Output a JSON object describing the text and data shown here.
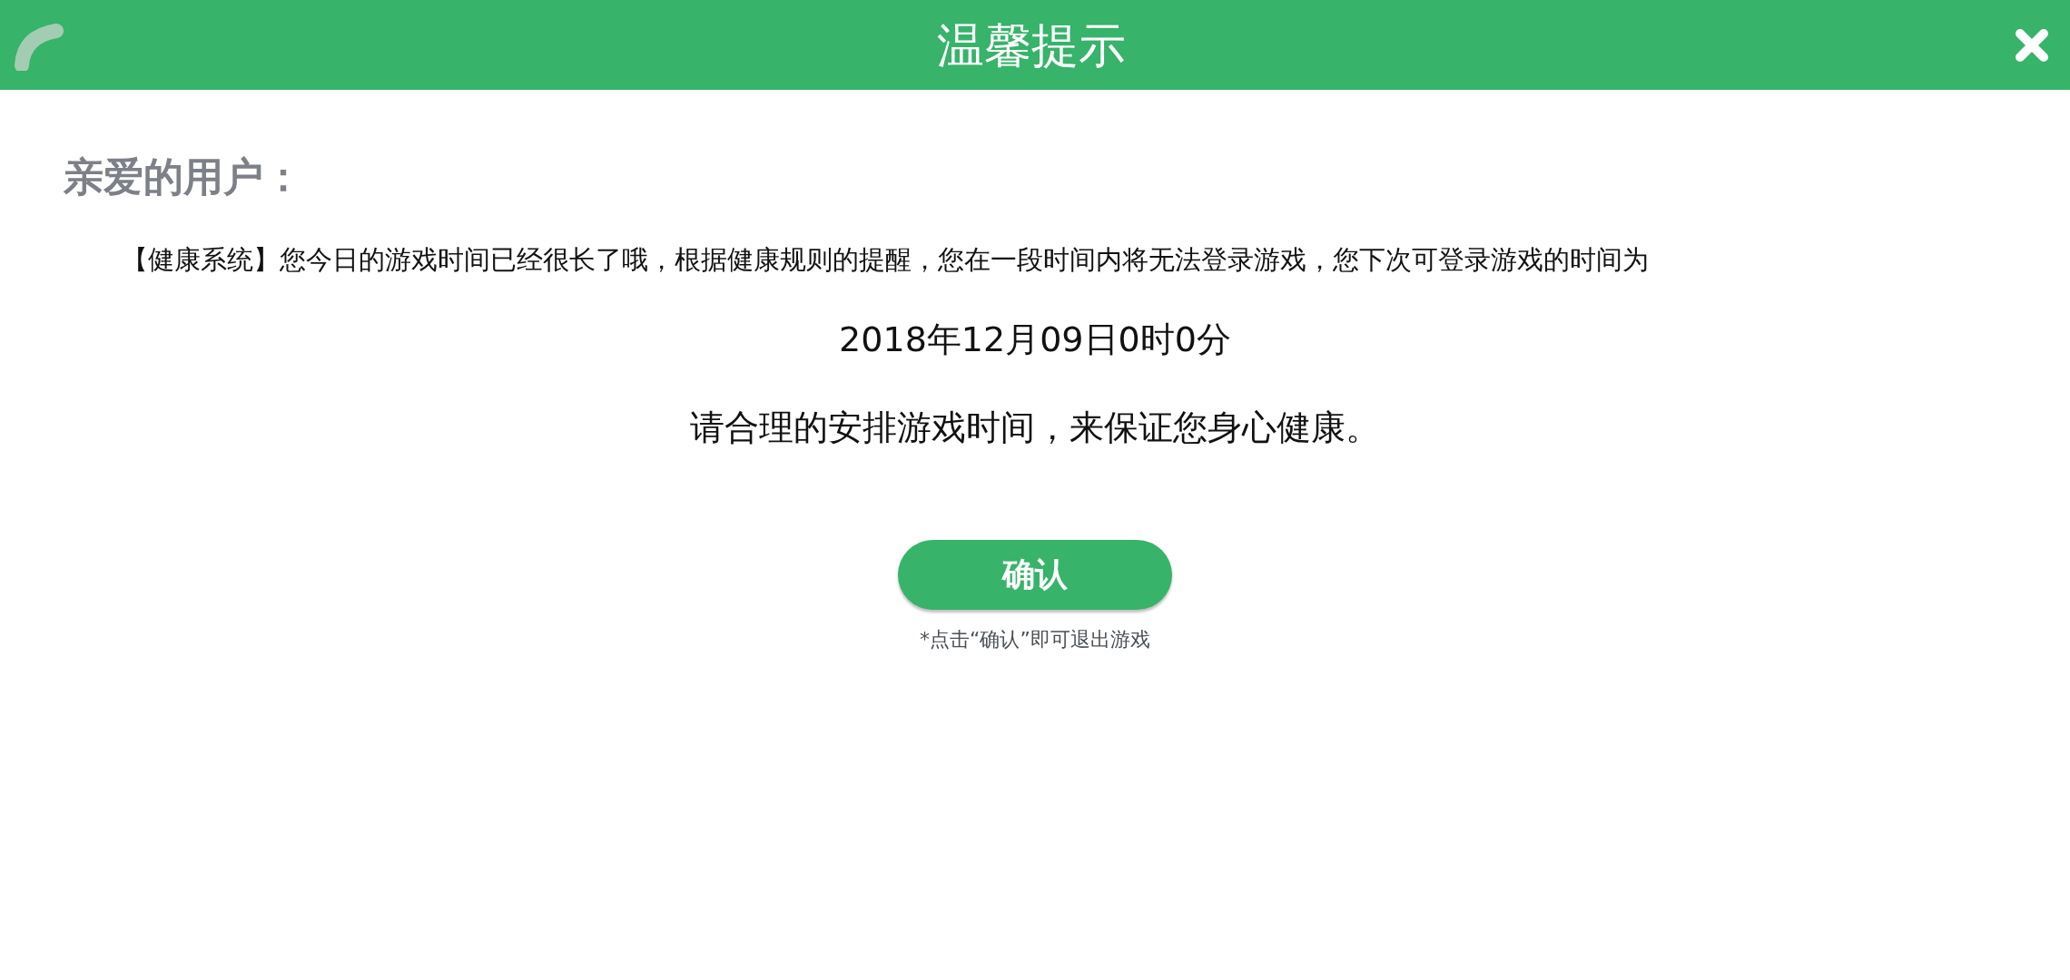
{
  "header": {
    "title": "温馨提示"
  },
  "greeting": "亲爱的用户：",
  "message": "【健康系统】您今日的游戏时间已经很长了哦，根据健康规则的提醒，您在一段时间内将无法登录游戏，您下次可登录游戏的时间为",
  "next_login_time": "2018年12月09日0时0分",
  "advice": "请合理的安排游戏时间，来保证您身心健康。",
  "confirm_button": "确认",
  "footnote": "*点击“确认”即可退出游戏"
}
